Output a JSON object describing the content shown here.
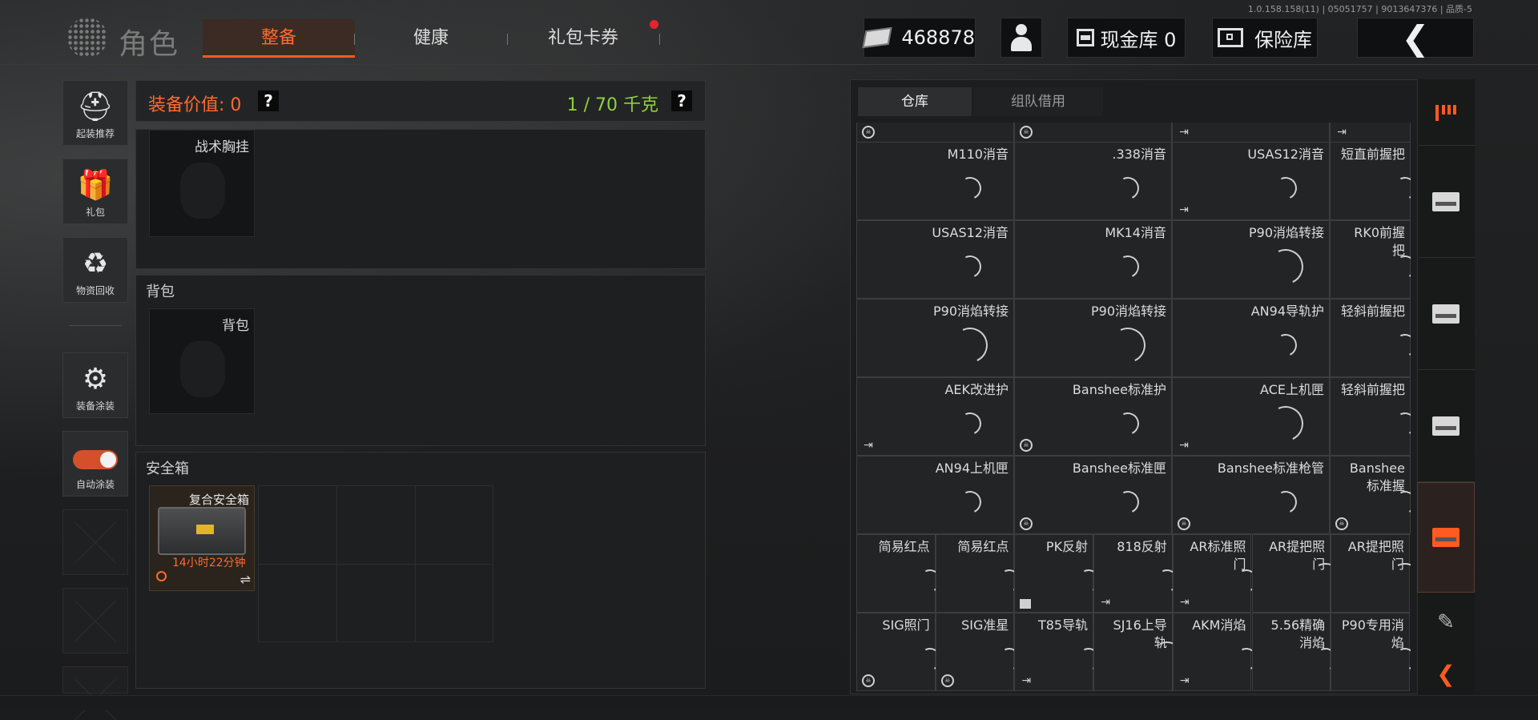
{
  "version": "1.0.158.158(11) | 05051757 | 9013647376 | 品质-5",
  "header": {
    "title": "角色",
    "tabs": [
      {
        "label": "整备",
        "active": true
      },
      {
        "label": "健康",
        "active": false
      },
      {
        "label": "礼包卡券",
        "active": false,
        "badge": true
      }
    ],
    "currency": "468878",
    "cash_vault": "现金库 0",
    "safe_vault": "保险库"
  },
  "sidebar": [
    {
      "label": "起装推荐",
      "icon": "helmet-icon"
    },
    {
      "label": "礼包",
      "icon": "gift-icon"
    },
    {
      "label": "物资回收",
      "icon": "recycle-icon"
    },
    {
      "label": "装备涂装",
      "icon": "paint-icon"
    },
    {
      "label": "自动涂装",
      "icon": "toggle-icon",
      "on": true
    }
  ],
  "equipment": {
    "value_label": "装备价值: 0",
    "weight_label": "1 / 70 千克",
    "help": "?",
    "chest_slot": "战术胸挂",
    "backpack_title": "背包",
    "backpack_slot": "背包",
    "safebox_title": "安全箱",
    "safebox_item": "复合安全箱",
    "safebox_timer": "14小时22分钟",
    "swap_glyph": "⇌"
  },
  "inventory": {
    "tabs": [
      {
        "label": "仓库",
        "active": true
      },
      {
        "label": "组队借用",
        "active": false
      }
    ],
    "rows": [
      [
        {
          "name": "",
          "mark": "skull"
        },
        {
          "name": "",
          "mark": "skull"
        },
        {
          "name": "",
          "mark": "exit"
        },
        {
          "name": "",
          "mark": "exit"
        }
      ],
      [
        {
          "name": "M110消音",
          "mark": ""
        },
        {
          "name": ".338消音",
          "mark": ""
        },
        {
          "name": "USAS12消音",
          "mark": "exit"
        },
        {
          "name": "短直前握把",
          "mark": ""
        }
      ],
      [
        {
          "name": "USAS12消音",
          "mark": ""
        },
        {
          "name": "MK14消音",
          "mark": ""
        },
        {
          "name": "P90消焰转接",
          "mark": ""
        },
        {
          "name": "RK0前握\n把",
          "mark": ""
        }
      ],
      [
        {
          "name": "P90消焰转接",
          "mark": ""
        },
        {
          "name": "P90消焰转接",
          "mark": ""
        },
        {
          "name": "AN94导轨护",
          "mark": ""
        },
        {
          "name": "轻斜前握把",
          "mark": ""
        }
      ],
      [
        {
          "name": "AEK改进护",
          "mark": "exit"
        },
        {
          "name": "Banshee标准护",
          "mark": "skull"
        },
        {
          "name": "ACE上机匣",
          "mark": "exit"
        },
        {
          "name": "轻斜前握把",
          "mark": ""
        }
      ],
      [
        {
          "name": "AN94上机匣",
          "mark": ""
        },
        {
          "name": "Banshee标准匣",
          "mark": "skull"
        },
        {
          "name": "Banshee标准枪管",
          "mark": "skull"
        },
        {
          "name": "Banshee\n标准握",
          "mark": "skull"
        }
      ]
    ],
    "small_rows": [
      [
        {
          "name": "简易红点",
          "mark": ""
        },
        {
          "name": "简易红点",
          "mark": ""
        },
        {
          "name": "PK反射",
          "mark": "box"
        },
        {
          "name": "818反射",
          "mark": "exit"
        },
        {
          "name": "AR标准照\n门",
          "mark": "exit"
        },
        {
          "name": "AR提把照\n门",
          "mark": ""
        },
        {
          "name": "AR提把照\n门",
          "mark": ""
        }
      ],
      [
        {
          "name": "SIG照门",
          "mark": "skull"
        },
        {
          "name": "SIG准星",
          "mark": "skull"
        },
        {
          "name": "T85导轨",
          "mark": "exit"
        },
        {
          "name": "SJ16上导\n轨",
          "mark": ""
        },
        {
          "name": "AKM消焰",
          "mark": "exit"
        },
        {
          "name": "5.56精确\n消焰",
          "mark": ""
        },
        {
          "name": "P90专用消\n焰",
          "mark": ""
        }
      ]
    ]
  },
  "colors": {
    "accent": "#ff5a1f",
    "weight_ok": "#8fd13b",
    "badge": "#e8222a"
  }
}
